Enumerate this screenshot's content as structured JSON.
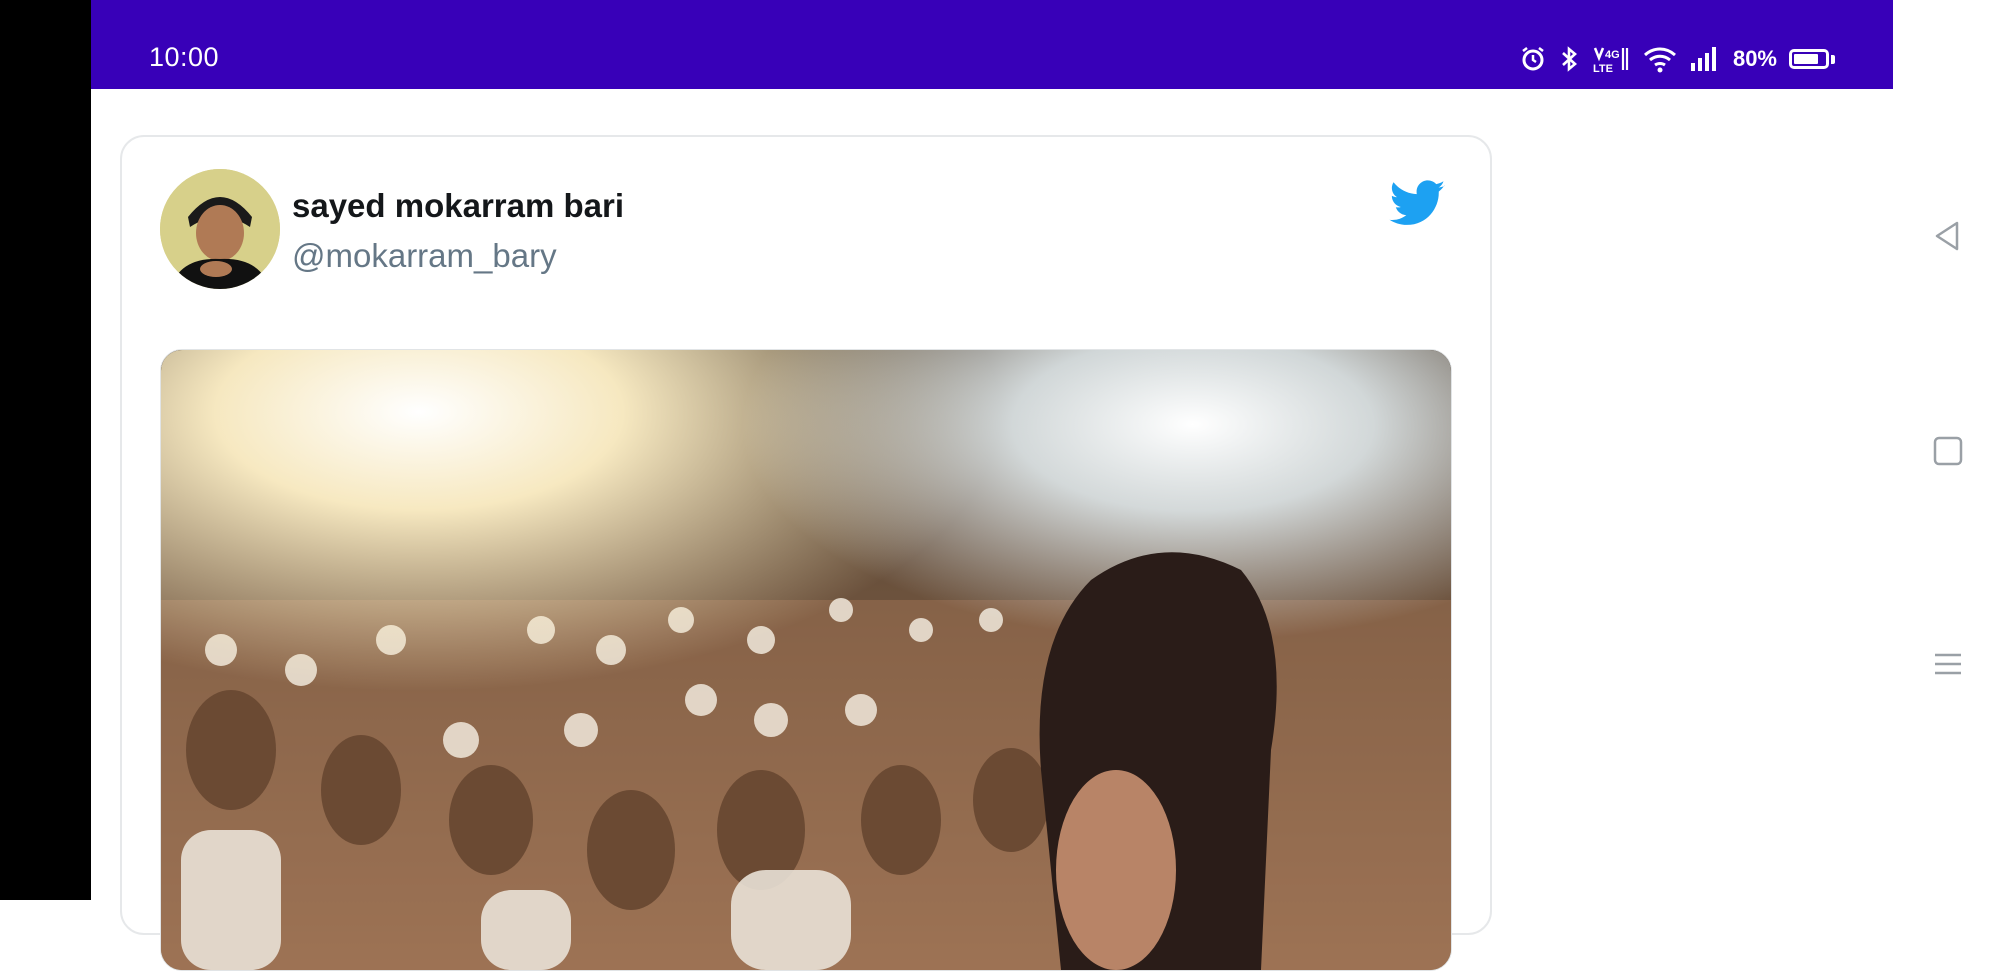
{
  "status_bar": {
    "time": "10:00",
    "battery_text": "80%",
    "battery_level": 0.8,
    "background_color": "#3800b8",
    "icons": [
      "alarm-icon",
      "bluetooth-icon",
      "volte-icon",
      "wifi-icon",
      "signal-icon",
      "battery-icon"
    ]
  },
  "tweet": {
    "user_name": "sayed mokarram bari",
    "user_handle": "@mokarram_bary",
    "brand_icon": "twitter-bird-icon",
    "brand_color": "#1da1f2"
  },
  "nav": {
    "items": [
      "back-icon",
      "home-icon",
      "menu-icon"
    ]
  }
}
